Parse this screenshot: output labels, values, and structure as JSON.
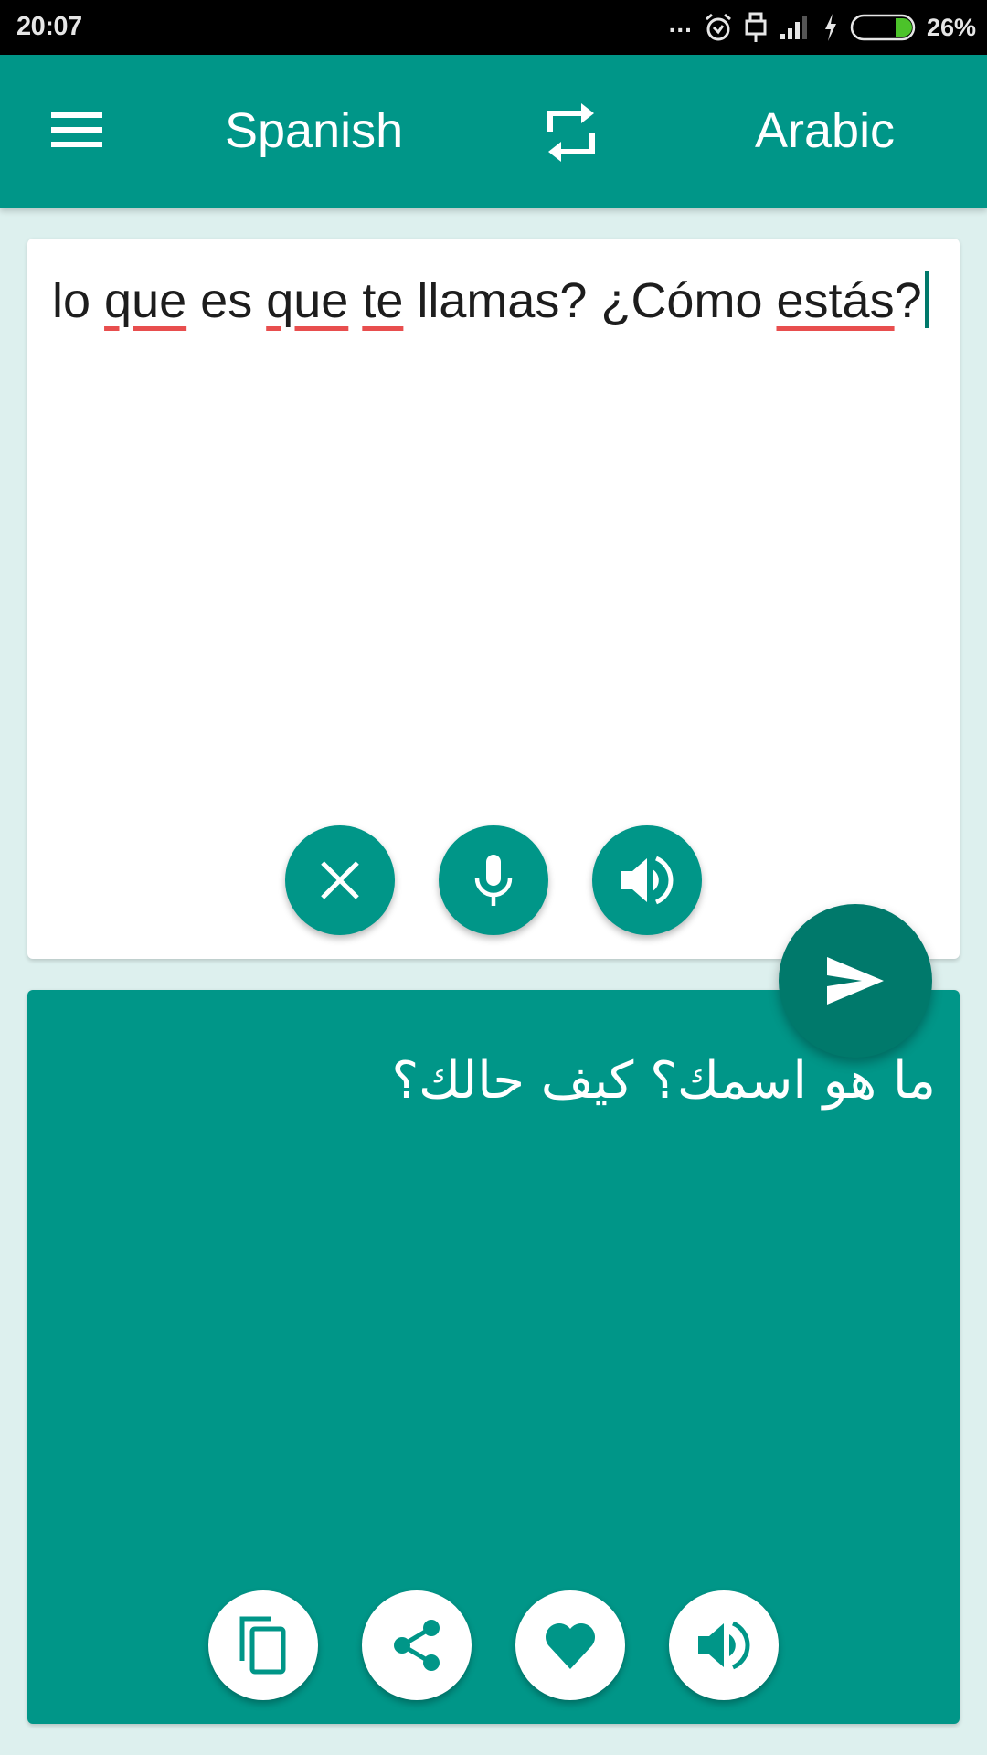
{
  "status_bar": {
    "time": "20:07",
    "overflow": "...",
    "icons": [
      "alarm-icon",
      "usb-icon",
      "signal-icon",
      "charging-icon",
      "battery-icon"
    ],
    "battery_level_percent": 26,
    "battery_label": "26%",
    "battery_fill_color": "#4cc32a"
  },
  "toolbar": {
    "menu_icon": "hamburger-menu-icon",
    "source_language": "Spanish",
    "swap_icon": "swap-languages-icon",
    "target_language": "Arabic",
    "color": "#009688"
  },
  "input": {
    "segments": [
      {
        "text": "lo ",
        "misspelled": false
      },
      {
        "text": "que",
        "misspelled": true
      },
      {
        "text": " es ",
        "misspelled": false
      },
      {
        "text": "que",
        "misspelled": true
      },
      {
        "text": " ",
        "misspelled": false
      },
      {
        "text": "te",
        "misspelled": true
      },
      {
        "text": " llamas? ¿Cómo ",
        "misspelled": false
      },
      {
        "text": "estás",
        "misspelled": true
      },
      {
        "text": "?",
        "misspelled": false
      }
    ],
    "full_text": "lo que es que te llamas? ¿Cómo estás?",
    "buttons": [
      {
        "name": "clear",
        "icon": "close-icon"
      },
      {
        "name": "voice-input",
        "icon": "microphone-icon"
      },
      {
        "name": "speak-source",
        "icon": "speaker-icon"
      }
    ]
  },
  "translate_button": {
    "icon": "send-icon",
    "color": "#00796b"
  },
  "output": {
    "text": "ما هو اسمك؟ كيف حالك؟",
    "buttons": [
      {
        "name": "copy",
        "icon": "copy-icon"
      },
      {
        "name": "share",
        "icon": "share-icon"
      },
      {
        "name": "favorite",
        "icon": "heart-icon"
      },
      {
        "name": "speak-translation",
        "icon": "speaker-icon"
      }
    ]
  }
}
